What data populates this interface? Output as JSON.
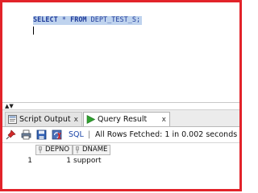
{
  "editor": {
    "sql_keyword_select": "SELECT",
    "sql_star": " * ",
    "sql_keyword_from": "FROM",
    "sql_table": " DEPT_TEST_S;"
  },
  "tabs": [
    {
      "label": "Script Output",
      "close": "x",
      "icon": "script-output-icon"
    },
    {
      "label": "Query Result",
      "close": "x",
      "icon": "run-arrow-icon"
    }
  ],
  "toolbar": {
    "sql_label": "SQL",
    "separator": "|",
    "status": "All Rows Fetched: 1 in 0.002 seconds",
    "icons": [
      "pin-icon",
      "print-icon",
      "save-icon",
      "refresh-icon"
    ]
  },
  "grid": {
    "columns": [
      "DEPNO",
      "DNAME"
    ],
    "rows": [
      {
        "num": "1",
        "depno": "1",
        "dname": "support"
      }
    ]
  },
  "colors": {
    "frame_border": "#e2232a",
    "selection": "#bfd3ee",
    "keyword": "#1f3b9a",
    "run_arrow": "#2fa12f"
  }
}
